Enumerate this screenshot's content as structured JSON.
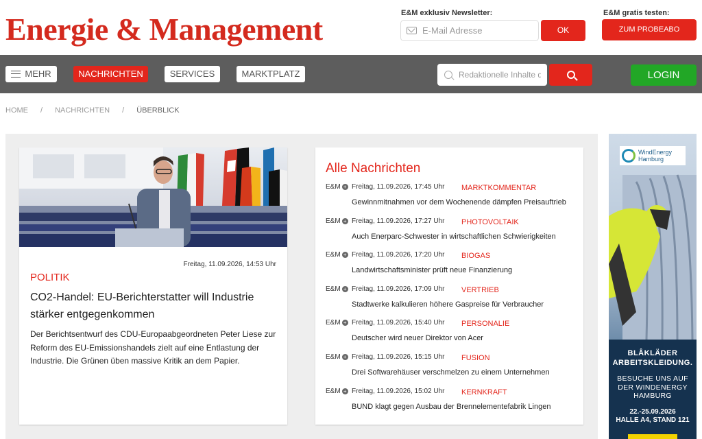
{
  "header": {
    "logo": "Energie & Management",
    "newsletter_label": "E&M exklusiv Newsletter:",
    "email_placeholder": "E-Mail Adresse",
    "ok_label": "OK",
    "try_label": "E&M gratis testen:",
    "probeabo_label": "ZUM PROBEABO"
  },
  "nav": {
    "mehr": "MEHR",
    "nachrichten": "NACHRICHTEN",
    "services": "SERVICES",
    "marktplatz": "MARKTPLATZ",
    "search_placeholder": "Redaktionelle Inhalte d",
    "login": "LOGIN"
  },
  "breadcrumb": [
    "HOME",
    "NACHRICHTEN",
    "ÜBERBLICK"
  ],
  "featured": {
    "date": "Freitag, 11.09.2026, 14:53 Uhr",
    "category": "POLITIK",
    "headline": "CO2-Handel: EU-Berichterstatter will Industrie stärker entgegenkommen",
    "teaser": "Der Berichtsentwurf des CDU-Europaabgeordneten Peter Liese zur Reform des EU-Emissionshandels zielt auf eine Entlastung der Industrie. Die Grünen üben massive Kritik an dem Papier."
  },
  "news": {
    "title": "Alle Nachrichten",
    "items": [
      {
        "source": "E&M",
        "date": "Freitag, 11.09.2026, 17:45 Uhr",
        "category": "MARKTKOMMENTAR",
        "title": "Gewinnmitnahmen vor dem Wochenende dämpfen Preisauftrieb"
      },
      {
        "source": "E&M",
        "date": "Freitag, 11.09.2026, 17:27 Uhr",
        "category": "PHOTOVOLTAIK",
        "title": "Auch Enerparc-Schwester in wirtschaftlichen Schwierigkeiten"
      },
      {
        "source": "E&M",
        "date": "Freitag, 11.09.2026, 17:20 Uhr",
        "category": "BIOGAS",
        "title": "Landwirtschaftsminister prüft neue Finanzierung"
      },
      {
        "source": "E&M",
        "date": "Freitag, 11.09.2026, 17:09 Uhr",
        "category": "VERTRIEB",
        "title": "Stadtwerke kalkulieren höhere Gaspreise für Verbraucher"
      },
      {
        "source": "E&M",
        "date": "Freitag, 11.09.2026, 15:40 Uhr",
        "category": "PERSONALIE",
        "title": "Deutscher wird neuer Direktor von Acer"
      },
      {
        "source": "E&M",
        "date": "Freitag, 11.09.2026, 15:15 Uhr",
        "category": "FUSION",
        "title": "Drei Softwarehäuser verschmelzen zu einem Unternehmen"
      },
      {
        "source": "E&M",
        "date": "Freitag, 11.09.2026, 15:02 Uhr",
        "category": "KERNKRAFT",
        "title": "BUND klagt gegen Ausbau der Brennelementefabrik Lingen"
      }
    ]
  },
  "ad": {
    "logo_line1": "WindEnergy",
    "logo_line2": "Hamburg",
    "line1": "BLÅKLÄDER",
    "line2": "ARBEITSKLEIDUNG.",
    "line3": "BESUCHE UNS AUF",
    "line4": "DER WINDENERGY",
    "line5": "HAMBURG",
    "line6": "22.-25.09.2026",
    "line7": "HALLE A4, STAND 121"
  },
  "colors": {
    "brand_red": "#e3261c",
    "login_green": "#22a726",
    "nav_gray": "#5d5d5d"
  }
}
